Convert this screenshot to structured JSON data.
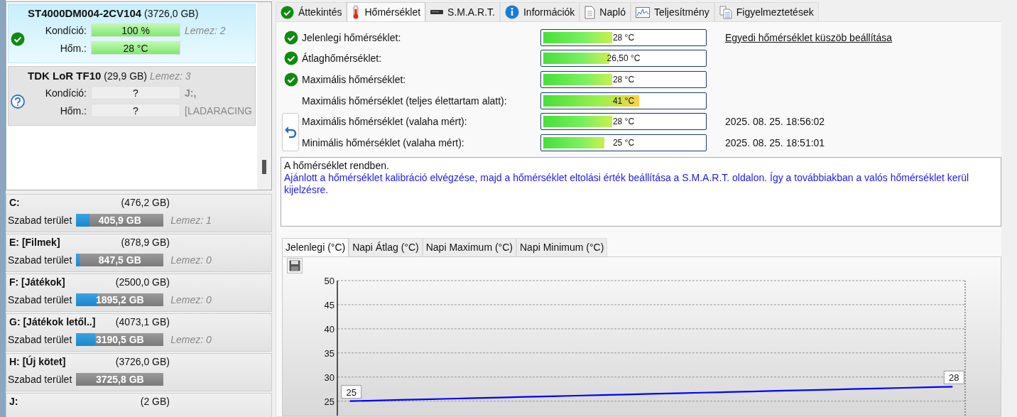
{
  "disks": [
    {
      "name": "ST4000DM004-2CV104",
      "size": "(3726,0 GB)",
      "selected": true,
      "kind": "ok",
      "health_label": "Kondíció:",
      "health": {
        "value": "100 %",
        "level": 1
      },
      "health_note": "Lemez: 2",
      "temp_label": "Hőm.:",
      "temp": {
        "value": "28 °C",
        "level": 1
      }
    },
    {
      "name": "TDK LoR TF10",
      "size": "(29,9 GB)",
      "selected": false,
      "kind": "unknown",
      "name_note": "Lemez: 3",
      "health_label": "Kondíció:",
      "health": {
        "value": "?"
      },
      "letter": "J:,",
      "temp_label": "Hőm.:",
      "temp": {
        "value": "?"
      },
      "volume": "[LADARACING"
    }
  ],
  "drives": [
    {
      "name": "C:",
      "size": "(476,2 GB)",
      "free_label": "Szabad terület",
      "free": "405,9 GB",
      "level": 0.15,
      "disk": "Lemez: 1"
    },
    {
      "name": "E: [Filmek]",
      "size": "(878,9 GB)",
      "free_label": "Szabad terület",
      "free": "847,5 GB",
      "level": 0.036,
      "disk": "Lemez: 0"
    },
    {
      "name": "F: [Játékok]",
      "size": "(2500,0 GB)",
      "free_label": "Szabad terület",
      "free": "1895,2 GB",
      "level": 0.24,
      "disk": "Lemez: 0"
    },
    {
      "name": "G: [Játékok letől..]",
      "size": "(4073,1 GB)",
      "free_label": "Szabad terület",
      "free": "3190,5 GB",
      "level": 0.217,
      "disk": "Lemez: 0"
    },
    {
      "name": "H: [Új kötet]",
      "size": "(3726,0 GB)",
      "free_label": "Szabad terület",
      "free": "3725,8 GB"
    },
    {
      "name": "J:",
      "size": "(2 GB)"
    }
  ],
  "tabs": [
    {
      "label": "Áttekintés",
      "selected": false
    },
    {
      "label": "Hőmérséklet",
      "selected": true
    },
    {
      "label": "S.M.A.R.T.",
      "selected": false
    },
    {
      "label": "Információk",
      "selected": false
    },
    {
      "label": "Napló",
      "selected": false
    },
    {
      "label": "Teljesítmény",
      "selected": false
    },
    {
      "label": "Figyelmeztetések",
      "selected": false
    }
  ],
  "temperatures": [
    {
      "label": "Jelenlegi hőmérséklet:",
      "ok": true,
      "value": "28 °C",
      "level": 0.42,
      "warning": false
    },
    {
      "label": "Átlaghőmérséklet:",
      "ok": true,
      "value": "26,50 °C",
      "level": 0.4,
      "warning": false
    },
    {
      "label": "Maximális hőmérséklet:",
      "ok": true,
      "value": "28 °C",
      "level": 0.42,
      "warning": false
    },
    {
      "label": "Maximális hőmérséklet (teljes élettartam alatt):",
      "ok": false,
      "value": "41 °C",
      "level": 0.58,
      "warning": true
    },
    {
      "label": "Maximális hőmérséklet (valaha mért):",
      "ok": false,
      "value": "28 °C",
      "level": 0.42,
      "warning": false,
      "date": "2025. 08. 25. 18:56:02"
    },
    {
      "label": "Minimális hőmérséklet (valaha mért):",
      "ok": false,
      "value": "25 °C",
      "level": 0.37,
      "warning": false,
      "date": "2025. 08. 25. 18:51:01"
    }
  ],
  "threshold_link": "Egyedi hőmérséklet küszöb beállítása",
  "messages": [
    {
      "text": "A hőmérséklet rendben.",
      "kind": "normal"
    },
    {
      "text": "Ajánlott a hőmérséklet kalibráció elvégzése, majd a hőmérséklet eltolási érték beállítása a S.M.A.R.T. oldalon. Így a továbbiakban a valós hőmérséklet kerül kijelzésre.",
      "kind": "info"
    }
  ],
  "chart_tabs": [
    {
      "label": "Jelenlegi (°C)",
      "selected": true
    },
    {
      "label": "Napi Átlag (°C)",
      "selected": false
    },
    {
      "label": "Napi Maximum (°C)",
      "selected": false
    },
    {
      "label": "Napi Minimum (°C)",
      "selected": false
    }
  ],
  "chart_data": {
    "type": "line",
    "categories": [
      null,
      null,
      null,
      null,
      null,
      null,
      null,
      null,
      null,
      null,
      null,
      null,
      null,
      null,
      null,
      null,
      null,
      null,
      null,
      null,
      null,
      null,
      null,
      null,
      null
    ],
    "series": [
      {
        "color": "#0000ff",
        "values": [
          25,
          25.125,
          25.25,
          25.375,
          25.5,
          25.625,
          25.75,
          25.875,
          26,
          26.125,
          26.25,
          26.375,
          26.5,
          26.625,
          26.75,
          26.875,
          27,
          27.125,
          27.25,
          27.375,
          27.5,
          27.625,
          27.75,
          27.875,
          28
        ]
      }
    ],
    "ylim": [
      22,
      50
    ],
    "yticks": [
      25,
      30,
      35,
      40,
      45,
      50
    ],
    "grid": true,
    "value_labels": [
      "25",
      null,
      null,
      null,
      null,
      null,
      null,
      null,
      null,
      null,
      null,
      null,
      null,
      null,
      null,
      null,
      null,
      null,
      null,
      null,
      null,
      null,
      null,
      null,
      "28"
    ]
  }
}
